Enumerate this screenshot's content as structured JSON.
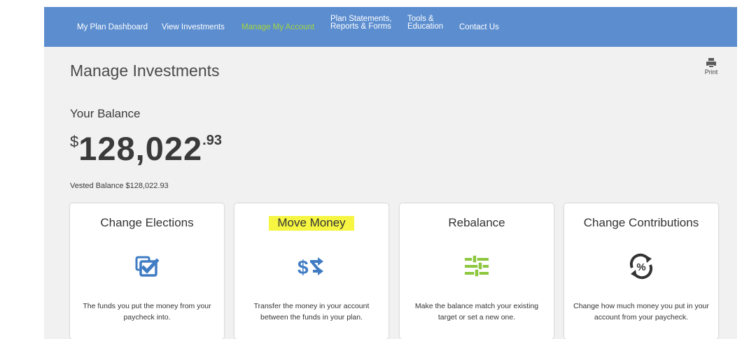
{
  "nav": {
    "items": [
      {
        "label": "My Plan Dashboard"
      },
      {
        "label": "View Investments"
      },
      {
        "label": "Manage My Account"
      },
      {
        "label": "Plan Statements,\nReports & Forms"
      },
      {
        "label": "Tools &\nEducation"
      },
      {
        "label": "Contact Us"
      }
    ],
    "active_color": "#a6d53c",
    "bar_color": "#5b8dcf"
  },
  "page": {
    "title": "Manage Investments",
    "print_label": "Print",
    "print_icon": "printer-icon"
  },
  "balance": {
    "label": "Your Balance",
    "currency": "$",
    "whole": "128,022",
    "cents": ".93",
    "vested": "Vested Balance $128,022.93"
  },
  "cards": [
    {
      "title": "Change Elections",
      "icon": "change-elections-icon",
      "desc": "The funds you put the money from your paycheck into."
    },
    {
      "title": "Move Money",
      "icon": "move-money-icon",
      "desc": "Transfer the money in your account between the funds in your plan.",
      "highlighted": true
    },
    {
      "title": "Rebalance",
      "icon": "rebalance-sliders-icon",
      "desc": "Make the balance match your existing target or set a new one."
    },
    {
      "title": "Change Contributions",
      "icon": "percent-cycle-icon",
      "desc": "Change how much money you put in your account from your paycheck."
    }
  ],
  "colors": {
    "icon_blue": "#3f7cc4",
    "icon_green": "#8dc63f",
    "icon_dark": "#333333",
    "highlight": "#f5f542"
  }
}
